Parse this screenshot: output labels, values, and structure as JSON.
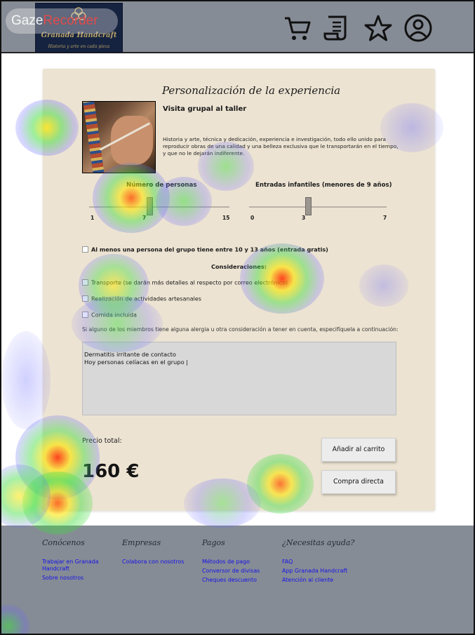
{
  "header": {
    "logo": {
      "name": "Granada Handcraft",
      "tagline": "Historia y arte en cada pieza"
    },
    "watermark": {
      "part1": "Gaze",
      "part2": "Recorder"
    },
    "icons": [
      "cart-icon",
      "receipt-icon",
      "star-icon",
      "user-icon"
    ]
  },
  "card": {
    "title": "Personalización de la experiencia",
    "visit_title": "Visita grupal al taller",
    "description": "Historia y arte, técnica y dedicación, experiencia e investigación, todo ello unido para reproducir obras de una calidad y una belleza exclusiva que le transportarán en el tiempo, y que no le dejarán indiferente.",
    "people_slider": {
      "label": "Número de personas",
      "min": "1",
      "value": "7",
      "max": "15",
      "fraction": 0.4286
    },
    "children_slider": {
      "label": "Entradas infantiles (menores de 9 años)",
      "min": "0",
      "value": "3",
      "max": "7",
      "fraction": 0.4286
    },
    "teen_check": {
      "prefix": "Al menos",
      "text": " una persona del grupo tiene entre 10 y 13 años (entrada gratis)"
    },
    "considerations_title": "Consideraciones:",
    "options": [
      "Transporte (se darán más detalles al respecto por correo electrónico)",
      "Realización de actividades artesanales",
      "Comida incluida"
    ],
    "allergy_question": "Si alguno de los miembros tiene alguna alergia u otra consideración a tener en cuenta, especifíquela a continuación:",
    "allergy_text": "Dermatitis irritante de contacto\nHoy personas celíacas en el grupo |",
    "price_label": "Precio total:",
    "price_value": "160 €",
    "add_to_cart": "Añadir al carrito",
    "buy_now": "Compra directa"
  },
  "footer": {
    "columns": [
      {
        "title": "Conócenos",
        "links": [
          "Trabajar en Granada Handcraft",
          "Sobre nosotros"
        ]
      },
      {
        "title": "Empresas",
        "links": [
          "Colabora con nosotros"
        ]
      },
      {
        "title": "Pagos",
        "links": [
          "Métodos de pago",
          "Conversor de divisas",
          "Cheques descuento"
        ]
      },
      {
        "title": "¿Necesitas ayuda?",
        "links": [
          "FAQ",
          "App Granada Handcraft",
          "Atención al cliente"
        ]
      }
    ]
  },
  "colors": {
    "header_bg": "#868c95",
    "card_bg": "#ece3d2",
    "link": "#1512e8",
    "logo_bg": "#152340"
  }
}
